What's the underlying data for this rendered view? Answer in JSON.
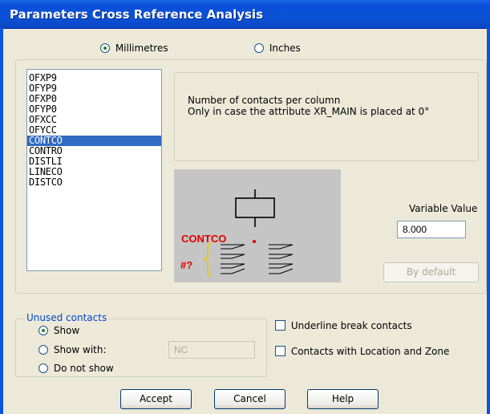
{
  "window": {
    "title": "Parameters Cross Reference Analysis"
  },
  "units": {
    "millimetres": "Millimetres",
    "inches": "Inches",
    "selected": "Millimetres"
  },
  "parameters": {
    "items": [
      "OFXP9",
      "OFYP9",
      "OFXP0",
      "OFYP0",
      "OFXCC",
      "OFYCC",
      "CONTCO",
      "CONTRO",
      "DISTLI",
      "LINECO",
      "DISTCO"
    ],
    "selected": "CONTCO"
  },
  "description": {
    "line1": "Number of contacts per column",
    "line2": "Only in case the attribute XR_MAIN is placed at 0°"
  },
  "illustration": {
    "label": "CONTCO",
    "marker": "#?"
  },
  "variable": {
    "label": "Variable Value",
    "value": "8.000",
    "default_button": "By default"
  },
  "unused_contacts": {
    "legend": "Unused contacts",
    "show": "Show",
    "show_with": "Show with:",
    "show_with_value": "NC",
    "do_not_show": "Do not show",
    "selected": "Show"
  },
  "options": {
    "underline_break": "Underline break contacts",
    "location_zone": "Contacts with Location and Zone"
  },
  "buttons": {
    "accept": "Accept",
    "cancel": "Cancel",
    "help": "Help"
  },
  "colors": {
    "title_bar": "#0a4ed8",
    "selection": "#316ac5",
    "illustration_bg": "#c5c5c5",
    "accent_red": "#e00000",
    "bracket_yellow": "#e8c800"
  }
}
